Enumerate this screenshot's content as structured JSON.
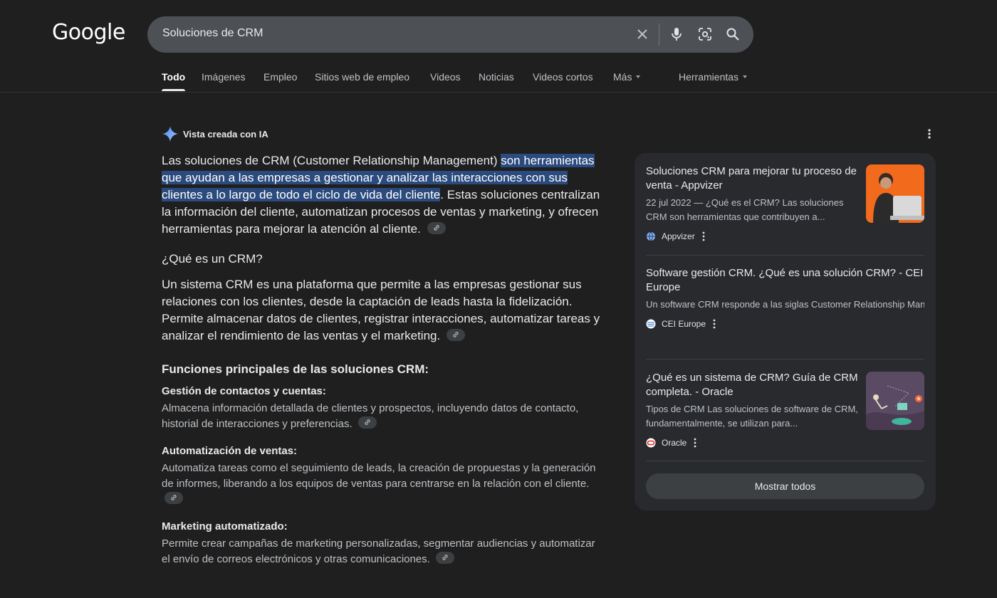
{
  "header": {
    "logo": "Google",
    "search_query": "Soluciones de CRM"
  },
  "tabs": {
    "todo": "Todo",
    "imagenes": "Imágenes",
    "empleo": "Empleo",
    "sitios": "Sitios web de empleo",
    "videos": "Videos",
    "noticias": "Noticias",
    "cortos": "Videos cortos",
    "mas": "Más",
    "herramientas": "Herramientas"
  },
  "ai": {
    "label": "Vista creada con IA",
    "intro_pre": "Las soluciones de CRM (Customer Relationship Management) ",
    "intro_hl": "son herramientas que ayudan a las empresas a gestionar y analizar las interacciones con sus clientes a lo largo de todo el ciclo de vida del cliente",
    "intro_post": ". Estas soluciones centralizan la información del cliente, automatizan procesos de ventas y marketing, y ofrecen herramientas para mejorar la atención al cliente.",
    "q_heading": "¿Qué es un CRM?",
    "q_body": "Un sistema CRM es una plataforma que permite a las empresas gestionar sus relaciones con los clientes, desde la captación de leads hasta la fidelización. Permite almacenar datos de clientes, registrar interacciones, automatizar tareas y analizar el rendimiento de las ventas y el marketing.",
    "funcs_heading": "Funciones principales de las soluciones CRM:",
    "features": [
      {
        "title": "Gestión de contactos y cuentas:",
        "body": "Almacena información detallada de clientes y prospectos, incluyendo datos de contacto, historial de interacciones y preferencias."
      },
      {
        "title": "Automatización de ventas:",
        "body": "Automatiza tareas como el seguimiento de leads, la creación de propuestas y la generación de informes, liberando a los equipos de ventas para centrarse en la relación con el cliente."
      },
      {
        "title": "Marketing automatizado:",
        "body": "Permite crear campañas de marketing personalizadas, segmentar audiencias y automatizar el envío de correos electrónicos y otras comunicaciones."
      }
    ]
  },
  "sources": [
    {
      "title": "Soluciones CRM para mejorar tu proceso de venta - Appvizer",
      "snippet": "22 jul 2022 — ¿Qué es el CRM? Las soluciones CRM son herramientas que contribuyen a...",
      "site": "Appvizer"
    },
    {
      "title": "Software gestión CRM. ¿Qué es una solución CRM? - CEI Europe",
      "snippet": "Un software CRM responde a las siglas Customer Relationship Management. Es una solución que permite registrar todas las...",
      "site": "CEI Europe"
    },
    {
      "title": "¿Qué es un sistema de CRM? Guía de CRM completa. - Oracle",
      "snippet": "Tipos de CRM Las soluciones de software de CRM, fundamentalmente, se utilizan para...",
      "site": "Oracle"
    }
  ],
  "show_all": "Mostrar todos",
  "colors": {
    "background": "#1f1f1f",
    "highlight": "#2b4a7d",
    "card": "#282a2e"
  }
}
